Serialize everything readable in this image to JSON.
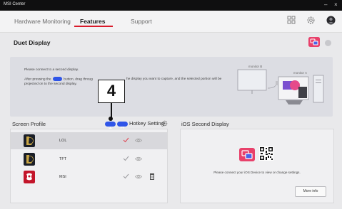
{
  "window": {
    "title": "MSI Center",
    "minimize": "–",
    "close": "×"
  },
  "nav": {
    "tabs": [
      {
        "label": "Hardware Monitoring"
      },
      {
        "label": "Features"
      },
      {
        "label": "Support"
      }
    ]
  },
  "section": {
    "title": "Duet Display"
  },
  "info": {
    "line1": "Please connect to a second display.",
    "line2_before": "After pressing the",
    "line2_mid": "button, drag throug",
    "line2_after": "he display you want to capture, and the selected portion will be",
    "line3": "projected on to the second display.",
    "monitor_b": "monitor B",
    "monitor_a": "monitor A"
  },
  "callout": {
    "number": "4"
  },
  "screen_profile": {
    "title": "Screen Profile",
    "hotkey_label": "Hotkey Setting",
    "rows": [
      {
        "name": "LOL",
        "selected": true,
        "icon_color": "#1b1f28",
        "accent": "#c9a646"
      },
      {
        "name": "TFT",
        "selected": false,
        "icon_color": "#1b1f28",
        "accent": "#c9a646"
      },
      {
        "name": "MSI",
        "selected": false,
        "icon_color": "#c3152a",
        "accent": "#ffffff"
      }
    ]
  },
  "ios": {
    "title": "iOS Second Display",
    "message": "Please connect your iOS Device to view or change settings.",
    "more_button": "More info"
  },
  "colors": {
    "accent_red": "#d91a2a",
    "accent_blue": "#2f55e8"
  }
}
